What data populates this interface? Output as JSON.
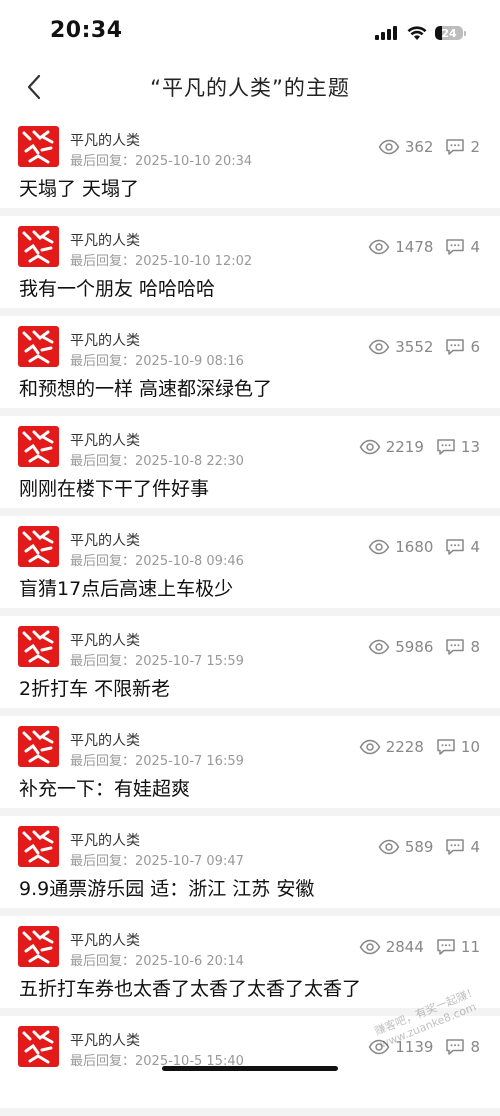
{
  "status_bar": {
    "time": "20:34",
    "battery": "24"
  },
  "nav": {
    "title": "“平凡的人类”的主题"
  },
  "threads": [
    {
      "author": "平凡的人类",
      "last_reply": "最后回复：2025-10-10 20:34",
      "views": "362",
      "replies": "2",
      "title": "天塌了 天塌了"
    },
    {
      "author": "平凡的人类",
      "last_reply": "最后回复：2025-10-10 12:02",
      "views": "1478",
      "replies": "4",
      "title": "我有一个朋友  哈哈哈哈"
    },
    {
      "author": "平凡的人类",
      "last_reply": "最后回复：2025-10-9 08:16",
      "views": "3552",
      "replies": "6",
      "title": "和预想的一样 高速都深绿色了"
    },
    {
      "author": "平凡的人类",
      "last_reply": "最后回复：2025-10-8 22:30",
      "views": "2219",
      "replies": "13",
      "title": "刚刚在楼下干了件好事"
    },
    {
      "author": "平凡的人类",
      "last_reply": "最后回复：2025-10-8 09:46",
      "views": "1680",
      "replies": "4",
      "title": "盲猜17点后高速上车极少"
    },
    {
      "author": "平凡的人类",
      "last_reply": "最后回复：2025-10-7 15:59",
      "views": "5986",
      "replies": "8",
      "title": "2折打车  不限新老"
    },
    {
      "author": "平凡的人类",
      "last_reply": "最后回复：2025-10-7 16:59",
      "views": "2228",
      "replies": "10",
      "title": "补充一下：有娃超爽"
    },
    {
      "author": "平凡的人类",
      "last_reply": "最后回复：2025-10-7 09:47",
      "views": "589",
      "replies": "4",
      "title": "9.9通票游乐园 适：浙江 江苏 安徽"
    },
    {
      "author": "平凡的人类",
      "last_reply": "最后回复：2025-10-6 20:14",
      "views": "2844",
      "replies": "11",
      "title": "五折打车券也太香了太香了太香了太香了"
    },
    {
      "author": "平凡的人类",
      "last_reply": "最后回复：2025-10-5 15:40",
      "views": "1139",
      "replies": "8",
      "title": ""
    }
  ],
  "watermark": "赚客吧，有奖一起赚！ www.zuanke8.com",
  "colors": {
    "avatar_red": "#e21a1a",
    "meta_gray": "#999999",
    "separator": "#f3f3f3"
  },
  "icons": {
    "back": "chevron-left-icon",
    "views": "eye-icon",
    "replies": "comment-icon"
  }
}
